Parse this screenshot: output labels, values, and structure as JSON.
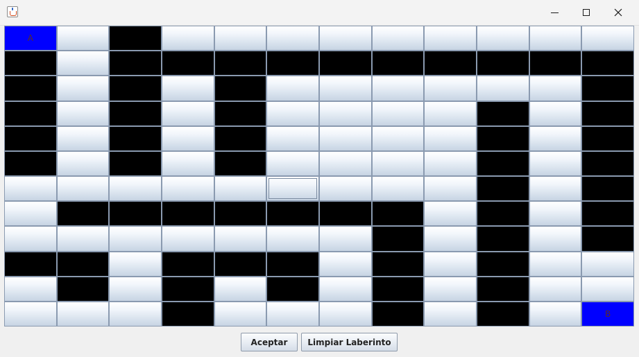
{
  "window": {
    "icon": "java-cup-icon",
    "controls": [
      "minimize-icon",
      "maximize-icon",
      "close-icon"
    ]
  },
  "maze": {
    "rows": [
      [
        "A",
        "",
        "#",
        "",
        "",
        "",
        "",
        "",
        "",
        "",
        "",
        ""
      ],
      [
        "#",
        "",
        "#",
        "#",
        "#",
        "#",
        "#",
        "#",
        "#",
        "#",
        "#",
        "#"
      ],
      [
        "#",
        "",
        "#",
        "",
        "#",
        "",
        "",
        "",
        "",
        "",
        "",
        "#"
      ],
      [
        "#",
        "",
        "#",
        "",
        "#",
        "",
        "",
        "",
        "",
        "#",
        "",
        "#"
      ],
      [
        "#",
        "",
        "#",
        "",
        "#",
        "",
        "",
        "",
        "",
        "#",
        "",
        "#"
      ],
      [
        "#",
        "",
        "#",
        "",
        "#",
        "",
        "",
        "",
        "",
        "#",
        "",
        "#"
      ],
      [
        "",
        "",
        "",
        "",
        "",
        "",
        "",
        "",
        "",
        "#",
        "",
        "#"
      ],
      [
        "",
        "#",
        "#",
        "#",
        "#",
        "#",
        "#",
        "#",
        "",
        "#",
        "",
        "#"
      ],
      [
        "",
        "",
        "",
        "",
        "",
        "",
        "",
        "#",
        "",
        "#",
        "",
        "#"
      ],
      [
        "#",
        "#",
        "",
        "#",
        "#",
        "#",
        "",
        "#",
        "",
        "#",
        "",
        ""
      ],
      [
        "",
        "#",
        "",
        "#",
        "",
        "#",
        "",
        "#",
        "",
        "#",
        "",
        ""
      ],
      [
        "",
        "",
        "",
        "#",
        "",
        "",
        "",
        "#",
        "",
        "#",
        "",
        "B"
      ]
    ],
    "focused_cell": [
      6,
      5
    ],
    "colors": {
      "wall": "#000000",
      "endpoint": "#0000ff",
      "path": "#e3eaf3"
    }
  },
  "buttons": {
    "accept_label": "Aceptar",
    "clear_label": "Limpiar Laberinto"
  }
}
